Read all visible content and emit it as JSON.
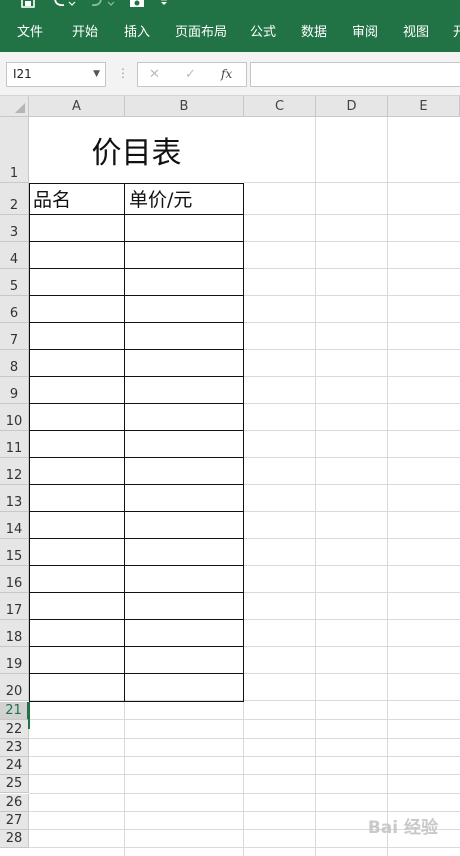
{
  "ribbon": {
    "tabs": [
      "文件",
      "开始",
      "插入",
      "页面布局",
      "公式",
      "数据",
      "审阅",
      "视图",
      "开"
    ]
  },
  "quick_access": {
    "save_icon": "save-icon",
    "undo_icon": "undo-icon",
    "redo_icon": "redo-icon",
    "camera_icon": "camera-icon",
    "customize_icon": "customize-icon"
  },
  "formula_bar": {
    "name_box": "I21",
    "fx_label": "fx",
    "formula": ""
  },
  "sheet": {
    "columns": [
      "A",
      "B",
      "C",
      "D",
      "E"
    ],
    "rows": [
      "1",
      "2",
      "3",
      "4",
      "5",
      "6",
      "7",
      "8",
      "9",
      "10",
      "11",
      "12",
      "13",
      "14",
      "15",
      "16",
      "17",
      "18",
      "19",
      "20",
      "21",
      "22",
      "23",
      "24",
      "25",
      "26",
      "27",
      "28"
    ],
    "title": "价目表",
    "header_a": "品名",
    "header_b": "单价/元",
    "selected_row": "21"
  },
  "watermark": "Bai 经验",
  "colors": {
    "accent": "#217346"
  }
}
